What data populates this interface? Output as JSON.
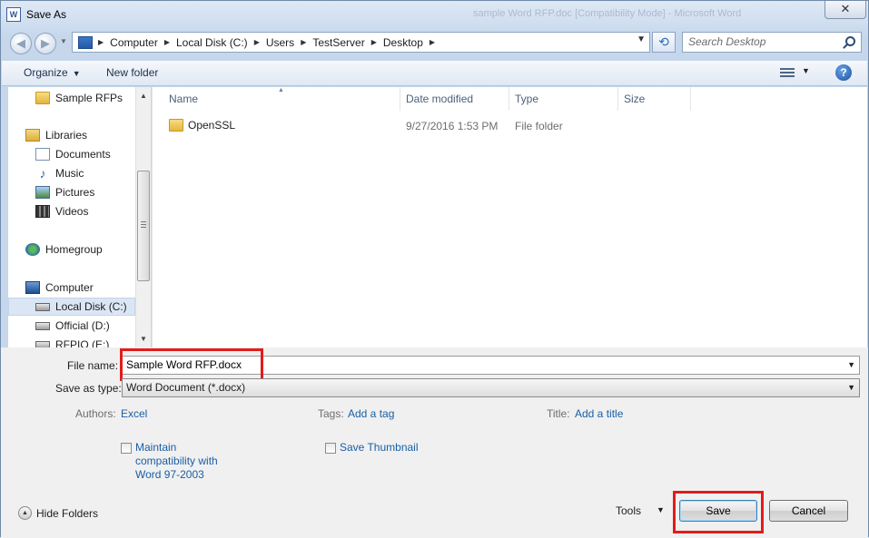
{
  "window": {
    "title": "Save As",
    "background_title": "sample Word RFP.doc [Compatibility Mode] - Microsoft Word",
    "close_glyph": "✕"
  },
  "address": {
    "crumbs": [
      "Computer",
      "Local Disk (C:)",
      "Users",
      "TestServer",
      "Desktop"
    ]
  },
  "search": {
    "placeholder": "Search Desktop"
  },
  "toolbar": {
    "organize": "Organize",
    "new_folder": "New folder",
    "help": "?"
  },
  "nav": {
    "items": [
      {
        "label": "Sample RFPs",
        "icon": "folder-icon"
      },
      {
        "label": "Libraries",
        "icon": "libraries-icon"
      },
      {
        "label": "Documents",
        "icon": "documents-icon"
      },
      {
        "label": "Music",
        "icon": "music-icon"
      },
      {
        "label": "Pictures",
        "icon": "pictures-icon"
      },
      {
        "label": "Videos",
        "icon": "videos-icon"
      },
      {
        "label": "Homegroup",
        "icon": "homegroup-icon"
      },
      {
        "label": "Computer",
        "icon": "computer-icon"
      },
      {
        "label": "Local Disk (C:)",
        "icon": "drive-icon"
      },
      {
        "label": "Official (D:)",
        "icon": "drive-icon"
      },
      {
        "label": "RFPIO (E:)",
        "icon": "drive-icon"
      }
    ],
    "selected": "Local Disk (C:)"
  },
  "file_list": {
    "columns": [
      "Name",
      "Date modified",
      "Type",
      "Size"
    ],
    "rows": [
      {
        "name": "OpenSSL",
        "date": "9/27/2016 1:53 PM",
        "type": "File folder",
        "size": ""
      }
    ]
  },
  "form": {
    "file_name_label": "File name:",
    "file_name_value": "Sample Word RFP.docx",
    "save_type_label": "Save as type:",
    "save_type_value": "Word Document (*.docx)",
    "authors_label": "Authors:",
    "authors_value": "Excel",
    "tags_label": "Tags:",
    "tags_value": "Add a tag",
    "title_label": "Title:",
    "title_value": "Add a title",
    "maintain_compat_line1": "Maintain",
    "maintain_compat_line2": "compatibility with",
    "maintain_compat_line3": "Word 97-2003",
    "save_thumbnail": "Save Thumbnail"
  },
  "footer": {
    "hide_folders": "Hide Folders",
    "tools": "Tools",
    "save": "Save",
    "cancel": "Cancel"
  },
  "colors": {
    "highlight": "#e21c1c",
    "link": "#1a5fa5",
    "selection": "#dbe6f4"
  }
}
